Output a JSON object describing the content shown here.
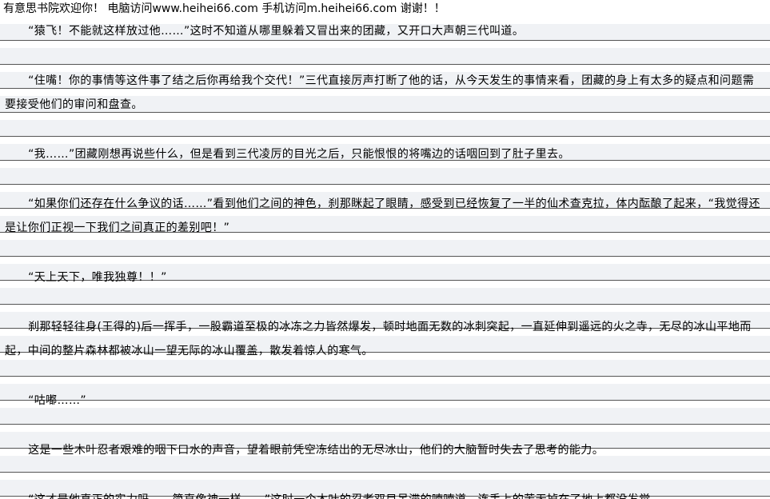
{
  "header": {
    "text": "有意思书院欢迎你！  电脑访问www.heihei66.com    手机访问m.heihei66.com  谢谢！！"
  },
  "paragraphs": [
    "      “猿飞！不能就这样放过他……”这时不知道从哪里躲着又冒出来的团藏，又开口大声朝三代叫道。",
    "      “住嘴！你的事情等这件事了结之后你再给我个交代！”三代直接厉声打断了他的话，从今天发生的事情来看，团藏的身上有太多的疑点和问题需要接受他们的审问和盘查。",
    "      “我……”团藏刚想再说些什么，但是看到三代凌厉的目光之后，只能恨恨的将嘴边的话咽回到了肚子里去。",
    "      “如果你们还存在什么争议的话……”看到他们之间的神色，刹那眯起了眼睛，感受到已经恢复了一半的仙术查克拉，体内酝酿了起来，“我觉得还是让你们正视一下我们之间真正的差别吧！”",
    "      “天上天下，唯我独尊！！”",
    "      刹那轻轻往身(王得的)后一挥手，一股霸道至极的冰冻之力皆然爆发，顿时地面无数的冰刺突起，一直延伸到遥远的火之寺，无尽的冰山平地而起，中间的整片森林都被冰山一望无际的冰山覆盖，散发着惊人的寒气。",
    "      “咕嘟……”",
    "      这是一些木叶忍者艰难的咽下口水的声音，望着眼前凭空冻结出的无尽冰山，他们的大脑暂时失去了思考的能力。",
    "      “这才是他真正的实力吗……简直像神一样……”这时一个木叶的忍者双目呆滞的喃喃道，连手上的苦无掉在了地上都没发觉"
  ]
}
